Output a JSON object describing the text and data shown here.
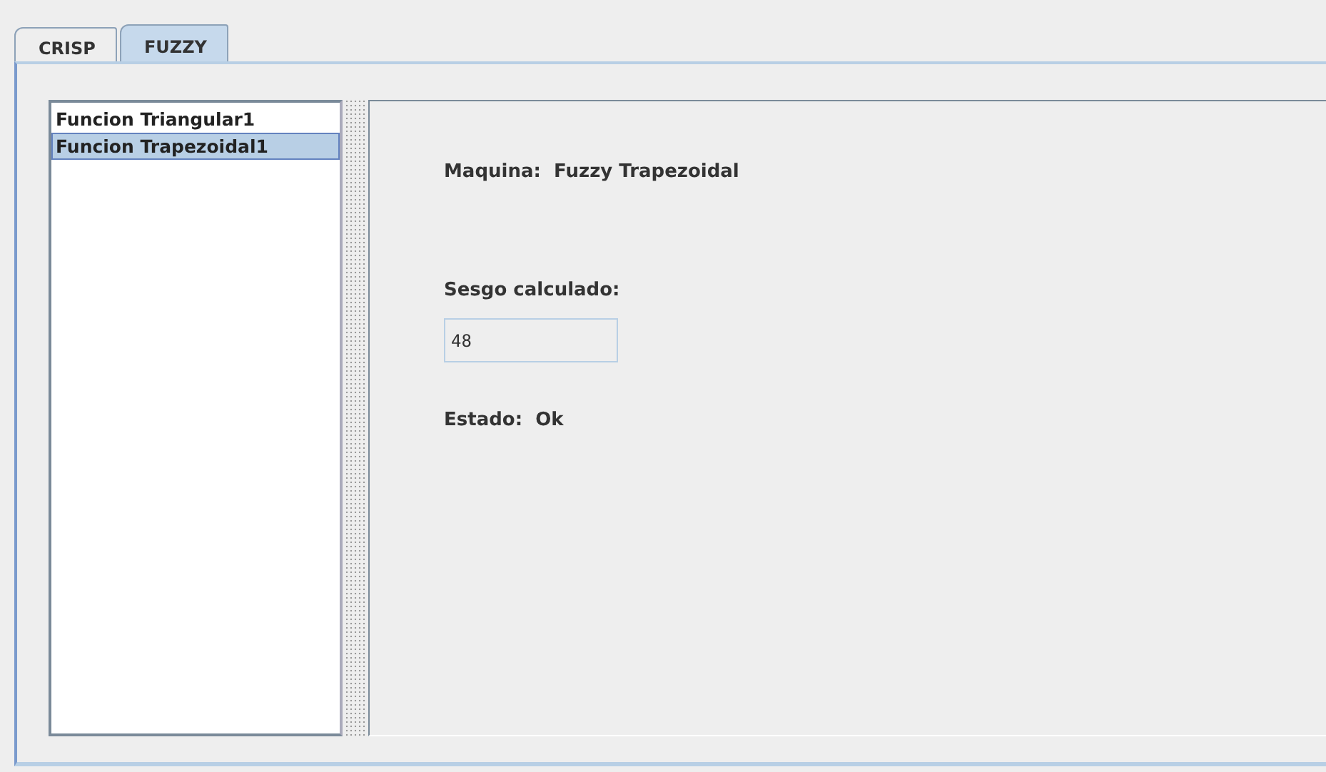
{
  "tabs": [
    {
      "label": "CRISP",
      "selected": false
    },
    {
      "label": "FUZZY",
      "selected": true
    }
  ],
  "functions": {
    "items": [
      {
        "label": "Funcion Triangular1",
        "selected": false
      },
      {
        "label": "Funcion Trapezoidal1",
        "selected": true
      }
    ]
  },
  "details": {
    "machine_label": "Maquina:",
    "machine_value": "Fuzzy Trapezoidal",
    "bias_label": "Sesgo calculado:",
    "bias_value": "48",
    "status_label": "Estado:",
    "status_value": "Ok"
  }
}
